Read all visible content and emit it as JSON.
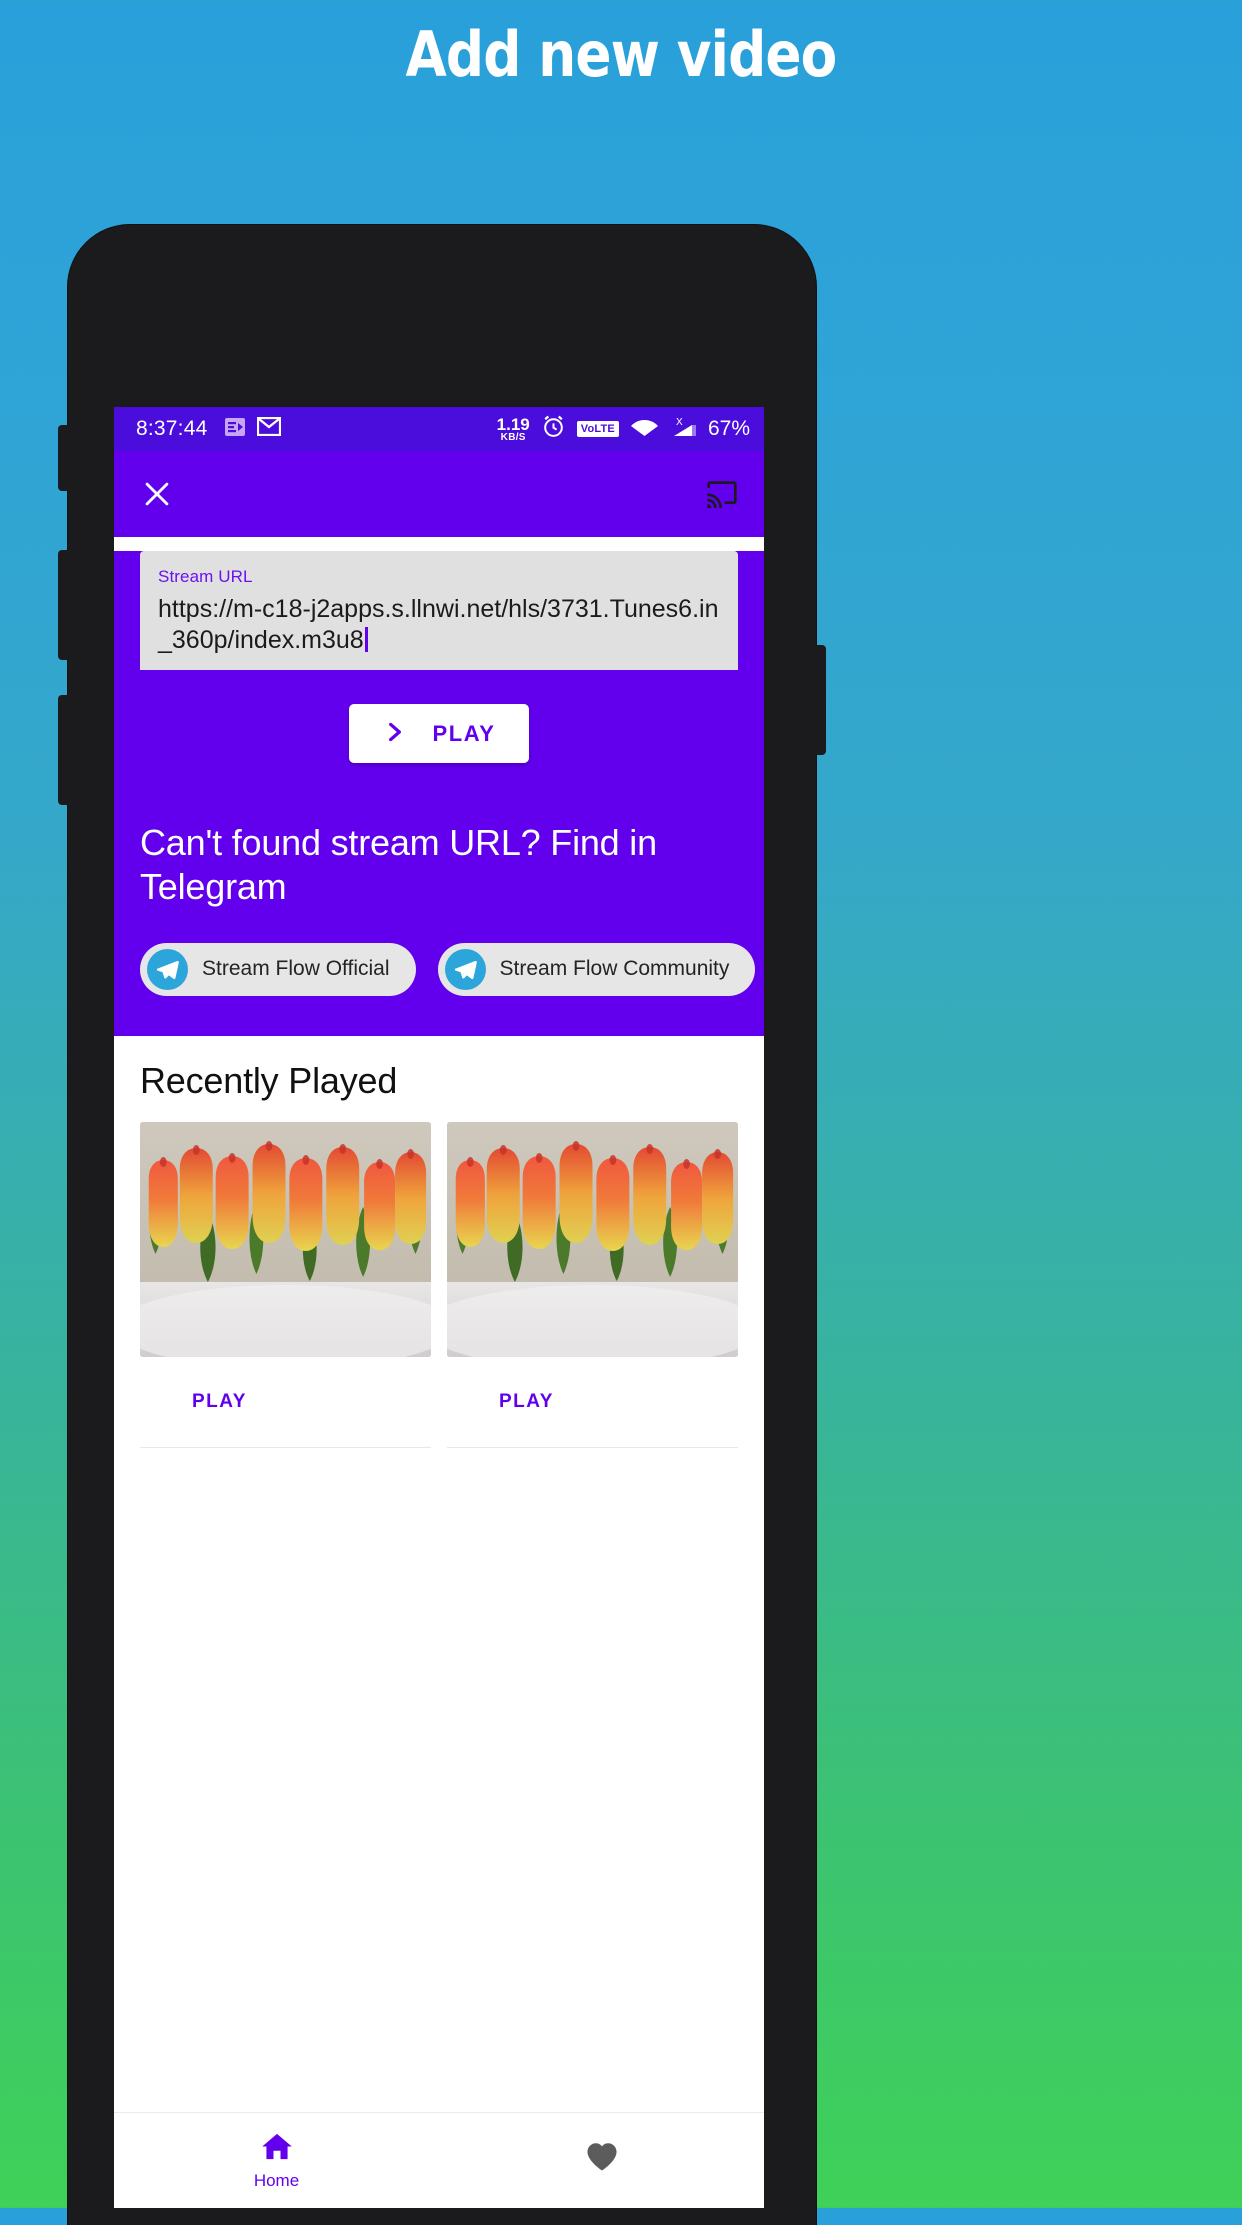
{
  "promo": {
    "title": "Add new video"
  },
  "statusbar": {
    "time": "8:37:44",
    "icons": [
      "notification-icon",
      "gmail-icon"
    ],
    "net_speed_value": "1.19",
    "net_speed_unit": "KB/S",
    "alarm": "alarm-icon",
    "volte": "VoLTE",
    "wifi": "wifi-icon",
    "signal": "signal-x-icon",
    "battery": "67%"
  },
  "appbar": {
    "close": "close-icon",
    "cast": "cast-icon"
  },
  "form": {
    "label": "Stream URL",
    "value": "https://m-c18-j2apps.s.llnwi.net/hls/3731.Tunes6.in_360p/index.m3u8",
    "placeholder": "Stream URL"
  },
  "actions": {
    "play_label": "PLAY",
    "play_icon": "play-chevron-icon"
  },
  "telegram": {
    "heading": "Can't found stream URL? Find in Telegram",
    "chips": [
      {
        "label": "Stream Flow Official",
        "icon": "telegram-icon"
      },
      {
        "label": "Stream Flow Community",
        "icon": "telegram-icon"
      }
    ]
  },
  "recent": {
    "title": "Recently Played",
    "cards": [
      {
        "play_label": "PLAY",
        "thumb": "tulips-thumbnail"
      },
      {
        "play_label": "PLAY",
        "thumb": "tulips-thumbnail"
      }
    ]
  },
  "bottomnav": {
    "items": [
      {
        "label": "Home",
        "icon": "home-icon",
        "active": true
      },
      {
        "label": "",
        "icon": "heart-icon",
        "active": false
      }
    ]
  },
  "colors": {
    "accent": "#6200ee",
    "statusbar": "#4b0ddb",
    "field_bg": "#e0e0e0",
    "telegram_blue": "#2ca5da",
    "inactive_nav": "#5c5c5c"
  }
}
